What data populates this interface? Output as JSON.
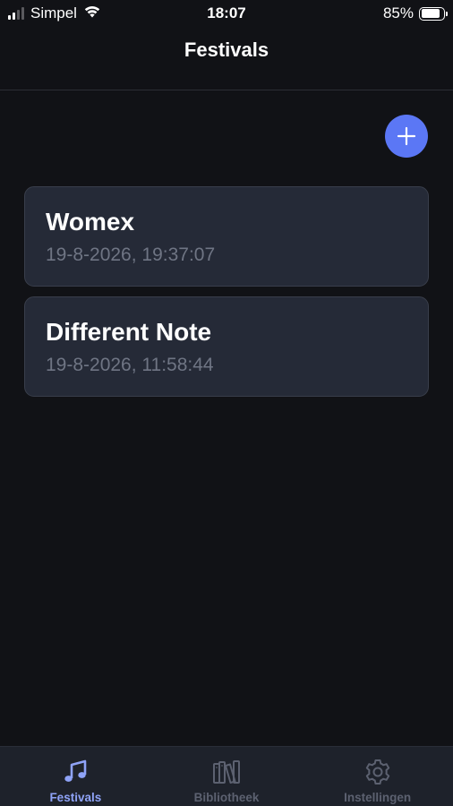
{
  "status_bar": {
    "carrier": "Simpel",
    "time": "18:07",
    "battery": "85%",
    "battery_level": 0.85
  },
  "header": {
    "title": "Festivals"
  },
  "add_button": {
    "icon": "plus-icon",
    "color": "#5b77f5"
  },
  "festivals": [
    {
      "name": "Womex",
      "date": "19-8-2026, 19:37:07"
    },
    {
      "name": "Different Note",
      "date": "19-8-2026, 11:58:44"
    }
  ],
  "tabs": [
    {
      "label": "Festivals",
      "icon": "music-note-icon",
      "active": true
    },
    {
      "label": "Bibliotheek",
      "icon": "library-icon",
      "active": false
    },
    {
      "label": "Instellingen",
      "icon": "gear-icon",
      "active": false
    }
  ],
  "colors": {
    "background": "#111216",
    "card": "#252a37",
    "accent": "#5b77f5",
    "tab_active": "#8fa3f7",
    "tab_inactive": "#5c6170"
  }
}
